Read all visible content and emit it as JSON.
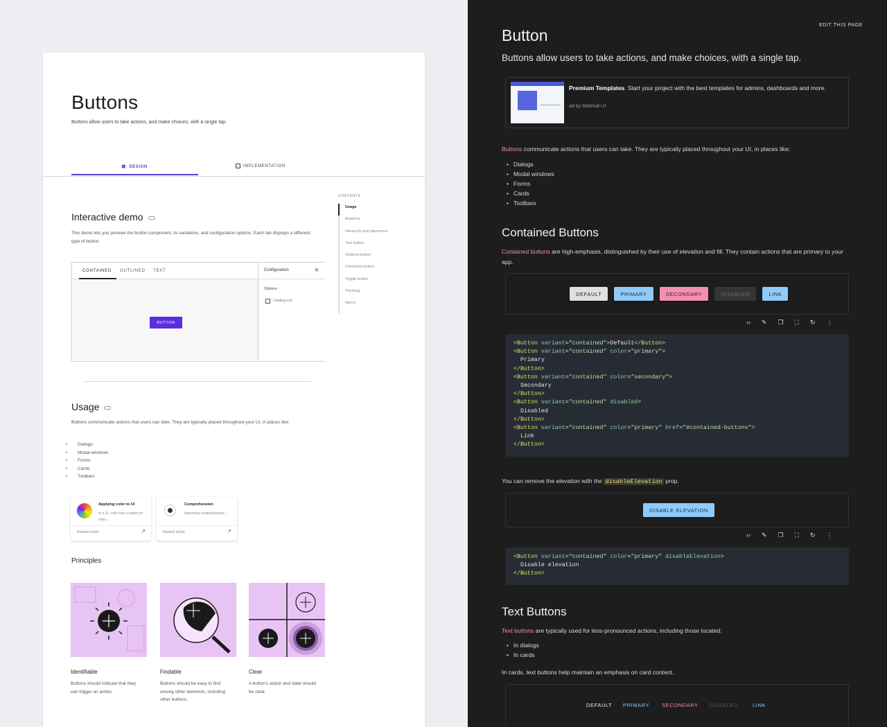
{
  "left": {
    "title": "Buttons",
    "subtitle": "Buttons allow users to take actions, and make choices, with a single tap.",
    "tabs": {
      "design": "DESIGN",
      "implementation": "IMPLEMENTATION"
    },
    "interactive_demo": {
      "heading": "Interactive demo",
      "desc": "This demo lets you preview the button component, its variations, and configuration options. Each tab displays a different type of button.",
      "tabs": [
        "CONTAINED",
        "OUTLINED",
        "TEXT"
      ],
      "button": "BUTTON",
      "config_title": "Configuration",
      "options_label": "Options",
      "checkbox_label": "Leading icon"
    },
    "usage": {
      "heading": "Usage",
      "desc": "Buttons communicate actions that users can take. They are typically placed throughout your UI, in places like:",
      "items": [
        "Dialogs",
        "Modal windows",
        "Forms",
        "Cards",
        "Toolbars"
      ]
    },
    "articles": [
      {
        "title": "Applying color to UI",
        "desc": "In a UI, color has a variety of roles:...",
        "footer": "Related article"
      },
      {
        "title": "Comprehension",
        "desc": "Improving comprehension...",
        "footer": "Related article"
      }
    ],
    "principles": {
      "heading": "Principles",
      "items": [
        {
          "title": "Identifiable",
          "desc": "Buttons should indicate that they can trigger an action."
        },
        {
          "title": "Findable",
          "desc": "Buttons should be easy to find among other elements, including other buttons."
        },
        {
          "title": "Clear",
          "desc": "A button's action and state should be clear."
        }
      ]
    },
    "contents": {
      "label": "CONTENTS",
      "items": [
        "Usage",
        "Anatomy",
        "Hierarchy and placement",
        "Text button",
        "Outlined button",
        "Contained button",
        "Toggle button",
        "Theming",
        "Specs"
      ]
    }
  },
  "right": {
    "edit": "EDIT THIS PAGE",
    "title": "Button",
    "subtitle": "Buttons allow users to take actions, and make choices, with a single tap.",
    "ad": {
      "bold": "Premium Templates",
      "text": ". Start your project with the best templates for admins, dashboards and more.",
      "by": "ad by Material-UI"
    },
    "intro_link": "Buttons",
    "intro_text": " communicate actions that users can take. They are typically placed throughout your UI, in places like:",
    "intro_items": [
      "Dialogs",
      "Modal windows",
      "Forms",
      "Cards",
      "Toolbars"
    ],
    "contained": {
      "heading": "Contained Buttons",
      "link": "Contained buttons",
      "text": " are high-emphasis, distinguished by their use of elevation and fill. They contain actions that are primary to your app.",
      "buttons": [
        "DEFAULT",
        "PRIMARY",
        "SECONDARY",
        "DISABLED",
        "LINK"
      ],
      "code": {
        "default": "Default",
        "primary": "Primary",
        "secondary": "Secondary",
        "disabled": "Disabled",
        "link": "Link",
        "variant_val": "\"contained\"",
        "primary_val": "\"primary\"",
        "secondary_val": "\"secondary\"",
        "href_val": "\"#contained-buttons\""
      },
      "elev_text_a": "You can remove the elevation with the ",
      "elev_code": "disableElevation",
      "elev_text_b": " prop.",
      "elev_button": "DISABLE ELEVATION",
      "elev_code_child": "Disable elevation"
    },
    "text_buttons": {
      "heading": "Text Buttons",
      "link": "Text buttons",
      "text": " are typically used for less-pronounced actions, including those located:",
      "items": [
        "In dialogs",
        "In cards"
      ],
      "note": "In cards, text buttons help maintain an emphasis on card content.",
      "buttons": [
        "DEFAULT",
        "PRIMARY",
        "SECONDARY",
        "DISABLED",
        "LINK"
      ]
    },
    "toolbar_icons": [
      "code-icon",
      "edit-icon",
      "copy-icon",
      "fullscreen-icon",
      "refresh-icon",
      "more-icon"
    ]
  },
  "colors": {
    "accent_purple": "#5b3bd6",
    "primary_light": "#90caf9",
    "secondary_light": "#f48fb1",
    "principle_bg": "#e8c4f5"
  }
}
